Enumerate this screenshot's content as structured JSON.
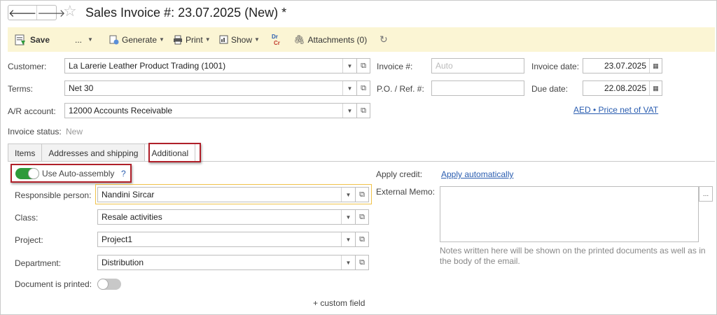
{
  "window": {
    "title": "Sales Invoice #:  23.07.2025 (New) *",
    "back_glyph": "🡐",
    "forward_glyph": "🡒",
    "star_glyph": "☆"
  },
  "toolbar": {
    "save": "Save",
    "more": "...",
    "generate": "Generate",
    "print": "Print",
    "show": "Show",
    "drcr_dr": "Dr",
    "drcr_cr": "Cr",
    "attachments": "Attachments (0)"
  },
  "header": {
    "customer_label": "Customer:",
    "customer_value": "La Larerie Leather Product Trading (1001)",
    "terms_label": "Terms:",
    "terms_value": "Net 30",
    "ar_label": "A/R account:",
    "ar_value": "12000 Accounts Receivable",
    "invoice_no_label": "Invoice #:",
    "invoice_no_placeholder": "Auto",
    "po_label": "P.O. / Ref. #:",
    "po_value": "",
    "invoice_date_label": "Invoice date:",
    "invoice_date_value": "23.07.2025",
    "due_date_label": "Due date:",
    "due_date_value": "22.08.2025",
    "currency_link": "AED • Price net of VAT",
    "status_label": "Invoice status:",
    "status_value": "New"
  },
  "tabs": [
    {
      "label": "Items"
    },
    {
      "label": "Addresses and shipping"
    },
    {
      "label": "Additional"
    }
  ],
  "additional": {
    "auto_assembly_label": "Use Auto-assembly",
    "auto_assembly_help": "?",
    "auto_assembly_on": true,
    "responsible_label": "Responsible person:",
    "responsible_value": "Nandini Sircar",
    "class_label": "Class:",
    "class_value": "Resale activities",
    "project_label": "Project:",
    "project_value": "Project1",
    "department_label": "Department:",
    "department_value": "Distribution",
    "printed_label": "Document is printed:",
    "printed_on": false,
    "custom_field": "+ custom field",
    "apply_credit_label": "Apply credit:",
    "apply_credit_link": "Apply automatically",
    "memo_label": "External Memo:",
    "memo_value": "",
    "memo_more": "...",
    "memo_note": "Notes written here will be shown on the printed documents as well as in the body of the email."
  },
  "colors": {
    "toolbar_bg": "#fbf5d4",
    "highlight_red": "#b0202a",
    "focus_yellow": "#f0c24a",
    "toggle_on": "#2e9a3a",
    "link_blue": "#2a5db0"
  }
}
